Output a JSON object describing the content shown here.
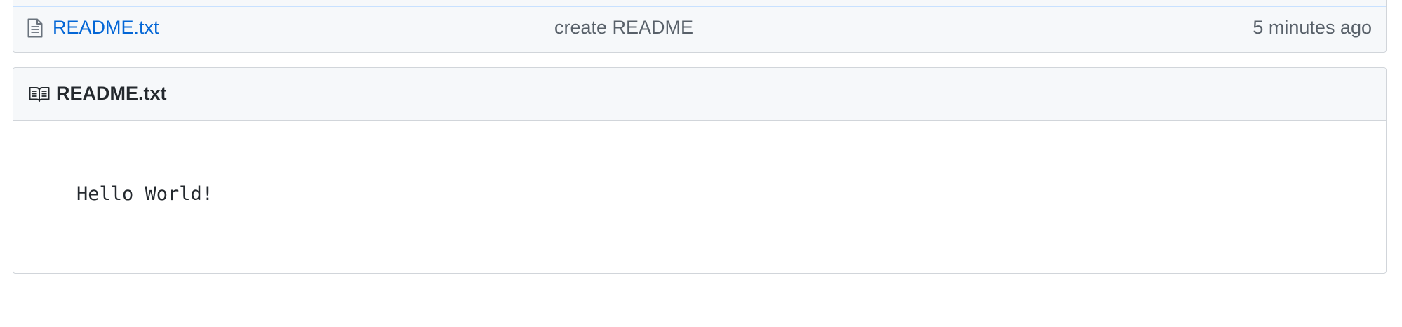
{
  "file_list": {
    "rows": [
      {
        "icon": "file-text-icon",
        "name": "README.txt",
        "commit_message": "create README",
        "age": "5 minutes ago"
      }
    ]
  },
  "readme": {
    "icon": "book-icon",
    "title": "README.txt",
    "content": "Hello World!"
  },
  "colors": {
    "link": "#0366d6",
    "muted": "#586069",
    "text": "#24292e",
    "header_bg": "#f6f8fa",
    "border": "#d1d5da",
    "highlight_border": "#c8e1ff"
  }
}
